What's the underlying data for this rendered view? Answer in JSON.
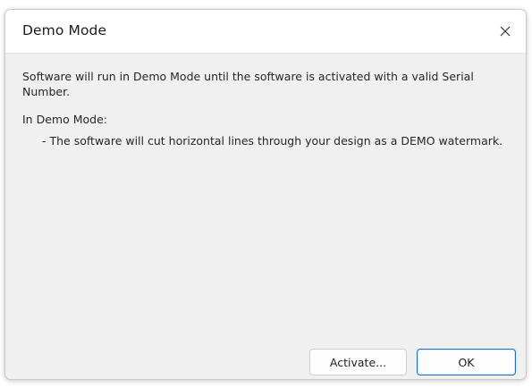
{
  "window": {
    "title": "Demo Mode",
    "close_icon": "close-icon"
  },
  "message": {
    "line1": "Software will run in Demo Mode until the software is activated with a valid Serial Number.",
    "heading": "In Demo Mode:",
    "bullet1": "- The software will cut horizontal lines through your design as a DEMO watermark."
  },
  "buttons": {
    "activate_label": "Activate...",
    "ok_label": "OK"
  },
  "colors": {
    "accent": "#1a73c6",
    "dialog_bg": "#f0f0f0"
  }
}
